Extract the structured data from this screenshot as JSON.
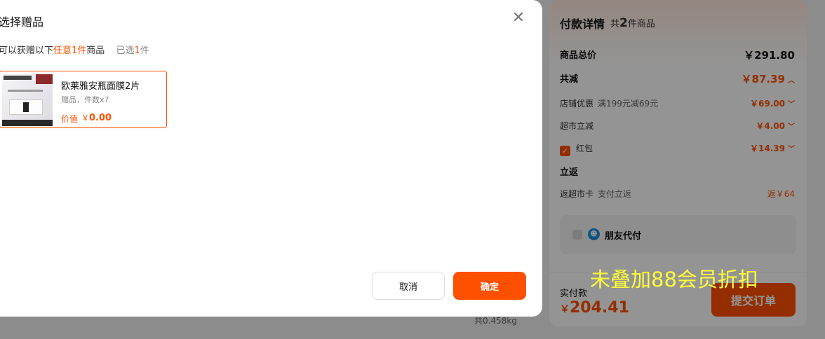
{
  "background": {
    "weight_text": "共0.458kg",
    "payment": {
      "title": "付款详情",
      "count_prefix": "共",
      "count": "2",
      "count_suffix": "件商品",
      "total_label": "商品总价",
      "total_value": "￥291.80",
      "discount_label": "共减",
      "discount_value": "￥87.39",
      "shop_label": "店铺优惠",
      "shop_sub": "满199元减69元",
      "shop_value": "￥69.00",
      "market_label": "超市立减",
      "market_value": "￥4.00",
      "redpack_label": "红包",
      "redpack_value": "￥14.39",
      "rebate_label": "立返",
      "card_label": "返超市卡",
      "card_sub": "支付立返",
      "card_value": "返￥64",
      "friend_label": "朋友代付",
      "actual_label": "实付款",
      "actual_yen": "￥",
      "actual_value": "204.41",
      "submit_label": "提交订单"
    }
  },
  "annotation": "未叠加88会员折扣",
  "modal": {
    "title": "选择赠品",
    "hint_prefix": "可以获赠以下",
    "hint_highlight": "任意1件",
    "hint_suffix": "商品",
    "selected_prefix": "已选",
    "selected_count": "1",
    "selected_suffix": "件",
    "gift": {
      "name": "欧莱雅安瓶面膜2片",
      "meta": "赠品，件数x7",
      "price_label": "价值",
      "price_yen": "￥",
      "price": "0.00"
    },
    "cancel_label": "取消",
    "ok_label": "确定"
  },
  "colors": {
    "accent": "#ff5000",
    "annotation": "#ffff3a"
  }
}
